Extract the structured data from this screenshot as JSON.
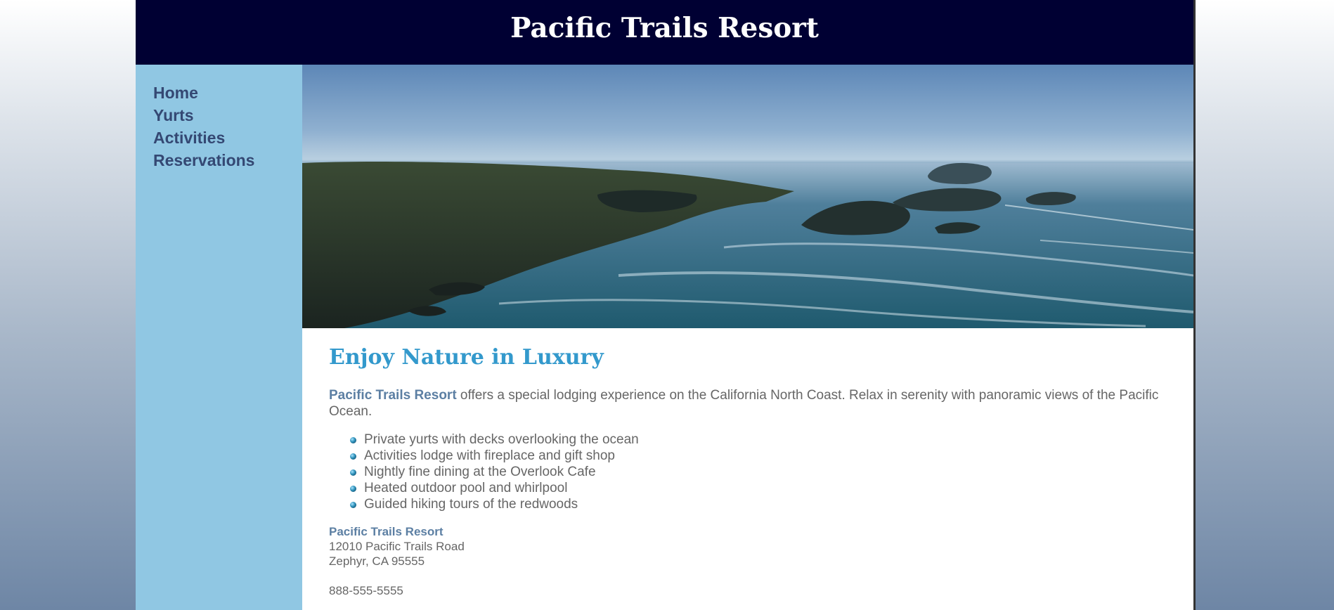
{
  "header": {
    "title": "Pacific Trails Resort"
  },
  "nav": {
    "items": [
      {
        "label": "Home"
      },
      {
        "label": "Yurts"
      },
      {
        "label": "Activities"
      },
      {
        "label": "Reservations"
      }
    ]
  },
  "hero": {
    "image_name": "coastline-photo"
  },
  "main": {
    "heading": "Enjoy Nature in Luxury",
    "intro_resort_name": "Pacific Trails Resort",
    "intro_text": " offers a special lodging experience on the California North Coast. Relax in serenity with panoramic views of the Pacific Ocean.",
    "features": [
      "Private yurts with decks overlooking the ocean",
      "Activities lodge with fireplace and gift shop",
      "Nightly fine dining at the Overlook Cafe",
      "Heated outdoor pool and whirlpool",
      "Guided hiking tours of the redwoods"
    ],
    "address": {
      "name": "Pacific Trails Resort",
      "street": "12010 Pacific Trails Road",
      "city": "Zephyr, CA 95555"
    },
    "phone": "888-555-5555"
  },
  "colors": {
    "header_bg": "#000033",
    "nav_bg": "#90c7e3",
    "nav_link": "#344873",
    "heading": "#3399cc",
    "resort_name": "#5c7fa3",
    "body_text": "#666666"
  }
}
